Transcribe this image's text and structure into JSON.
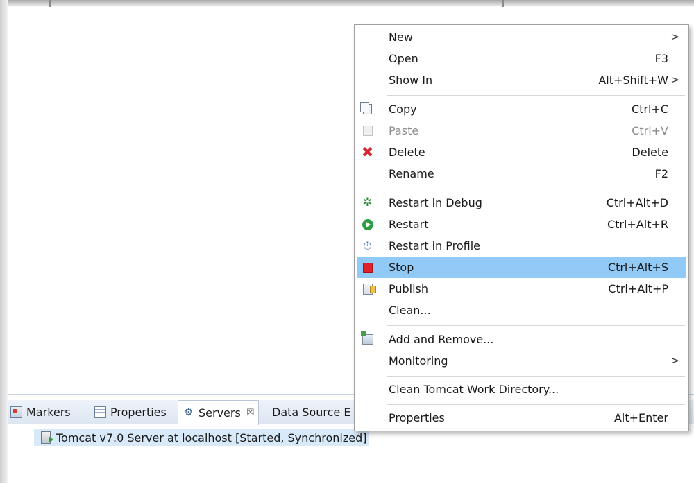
{
  "views": {
    "tabs": [
      {
        "label": "Markers",
        "icon": "markers-icon"
      },
      {
        "label": "Properties",
        "icon": "properties-icon"
      },
      {
        "label": "Servers",
        "icon": "servers-icon",
        "active": true,
        "close": "☒"
      },
      {
        "label": "Data Source E",
        "icon": ""
      }
    ],
    "server_row": {
      "label": "Tomcat v7.0 Server at localhost  [Started, Synchronized]",
      "icon": "server-started-icon"
    }
  },
  "context_menu": {
    "items": [
      {
        "label": "New",
        "accel": "",
        "submenu": true,
        "submenu_arrow": ">"
      },
      {
        "label": "Open",
        "accel": "F3"
      },
      {
        "label": "Show In",
        "accel": "Alt+Shift+W",
        "submenu": true,
        "submenu_arrow": ">"
      },
      {
        "label": "Copy",
        "accel": "Ctrl+C",
        "icon": "copy-icon"
      },
      {
        "label": "Paste",
        "accel": "Ctrl+V",
        "icon": "paste-icon",
        "disabled": true
      },
      {
        "label": "Delete",
        "accel": "Delete",
        "icon": "delete-icon"
      },
      {
        "label": "Rename",
        "accel": "F2"
      },
      {
        "label": "Restart in Debug",
        "accel": "Ctrl+Alt+D",
        "icon": "debug-icon"
      },
      {
        "label": "Restart",
        "accel": "Ctrl+Alt+R",
        "icon": "restart-icon"
      },
      {
        "label": "Restart in Profile",
        "accel": "",
        "icon": "profile-icon"
      },
      {
        "label": "Stop",
        "accel": "Ctrl+Alt+S",
        "icon": "stop-icon",
        "highlighted": true
      },
      {
        "label": "Publish",
        "accel": "Ctrl+Alt+P",
        "icon": "publish-icon"
      },
      {
        "label": "Clean...",
        "accel": ""
      },
      {
        "label": "Add and Remove...",
        "accel": "",
        "icon": "add-remove-icon"
      },
      {
        "label": "Monitoring",
        "accel": "",
        "submenu": true,
        "submenu_arrow": ">"
      },
      {
        "label": "Clean Tomcat Work Directory...",
        "accel": ""
      },
      {
        "label": "Properties",
        "accel": "Alt+Enter"
      }
    ]
  },
  "colors": {
    "menu_highlight": "#91c9f7",
    "selection_row": "#d8e9fa",
    "disabled_text": "#8d8d8d",
    "stop_red": "#e0202a"
  }
}
